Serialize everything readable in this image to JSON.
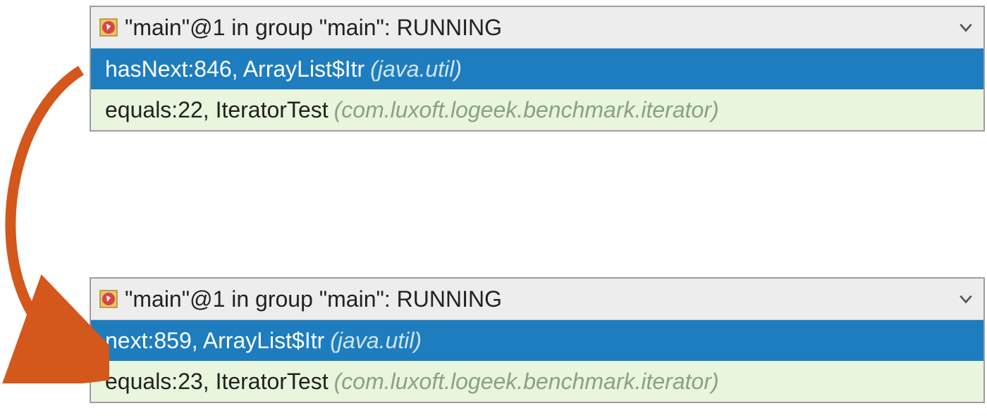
{
  "panel1": {
    "header": "\"main\"@1 in group \"main\": RUNNING",
    "frames": [
      {
        "method": "hasNext:846, ArrayList$Itr",
        "pkg": "(java.util)"
      },
      {
        "method": "equals:22, IteratorTest",
        "pkg": "(com.luxoft.logeek.benchmark.iterator)"
      }
    ]
  },
  "panel2": {
    "header": "\"main\"@1 in group \"main\": RUNNING",
    "frames": [
      {
        "method": "next:859, ArrayList$Itr",
        "pkg": "(java.util)"
      },
      {
        "method": "equals:23, IteratorTest",
        "pkg": "(com.luxoft.logeek.benchmark.iterator)"
      }
    ]
  }
}
